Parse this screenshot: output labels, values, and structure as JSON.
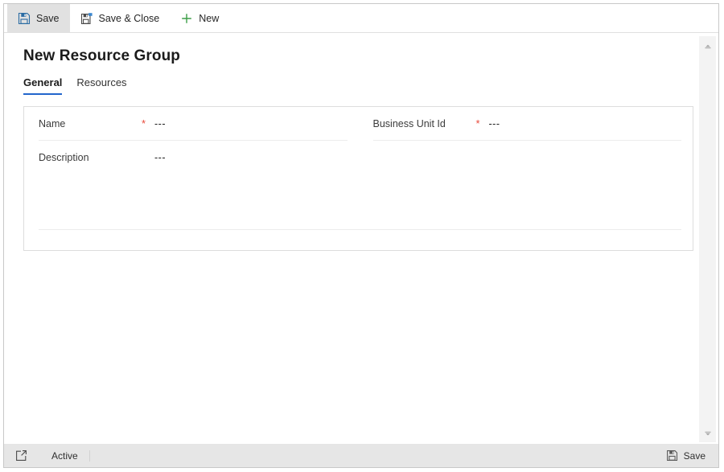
{
  "commandbar": {
    "buttons": [
      {
        "label": "Save",
        "icon": "save-floppy-icon",
        "state": "active"
      },
      {
        "label": "Save & Close",
        "icon": "save-and-close-floppy-icon",
        "state": "normal"
      },
      {
        "label": "New",
        "icon": "plus-icon",
        "state": "normal"
      }
    ]
  },
  "page": {
    "title": "New Resource Group",
    "tabs": [
      {
        "label": "General",
        "selected": true
      },
      {
        "label": "Resources",
        "selected": false
      }
    ]
  },
  "form": {
    "fields": [
      {
        "label": "Name",
        "required": true,
        "value": "---"
      },
      {
        "label": "Business Unit Id",
        "required": true,
        "value": "---"
      },
      {
        "label": "Description",
        "required": false,
        "value": "---"
      }
    ]
  },
  "scrollbar": {
    "up_arrow": "chevron-up-icon",
    "down_arrow": "chevron-down-icon"
  },
  "statusbar": {
    "popout_icon": "open-in-new-window-icon",
    "status": "Active",
    "save_label": "Save",
    "save_icon": "save-floppy-icon"
  },
  "colors": {
    "accent": "#2266cc",
    "required": "#e8493a",
    "new_icon": "#3c9e46",
    "toolbar_active": "#e1e1e1",
    "statusbar_bg": "#e6e6e6",
    "card_border": "#dddddd"
  }
}
